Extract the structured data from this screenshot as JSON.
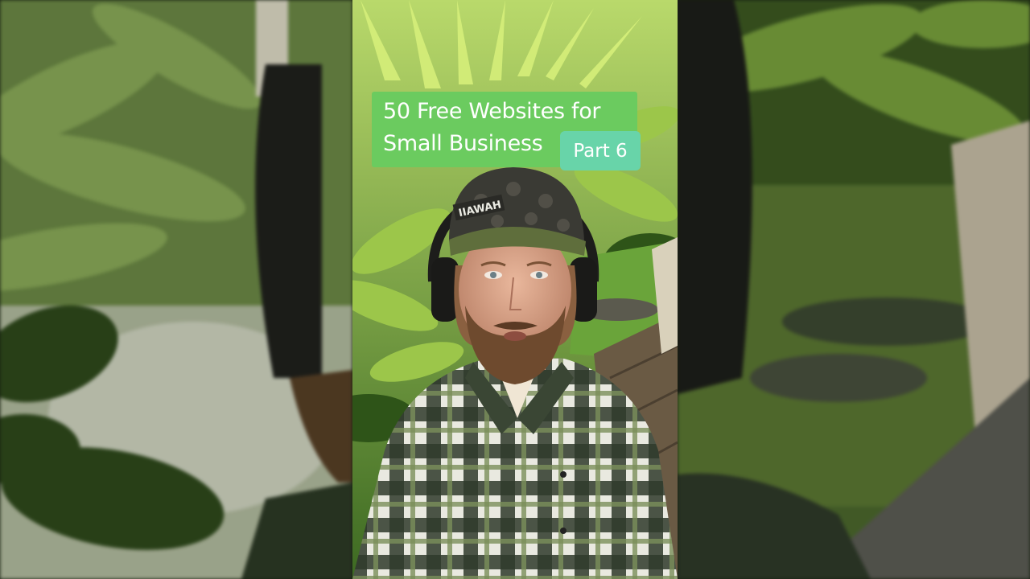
{
  "video": {
    "caption": {
      "line1": "50 Free Websites for",
      "line2": "Small Business",
      "badge": "Part 6"
    },
    "cap_text": "IIAWAH"
  },
  "colors": {
    "caption_bg": "#6bcb5f",
    "badge_bg": "#68d4a9",
    "caption_text": "#ffffff"
  }
}
